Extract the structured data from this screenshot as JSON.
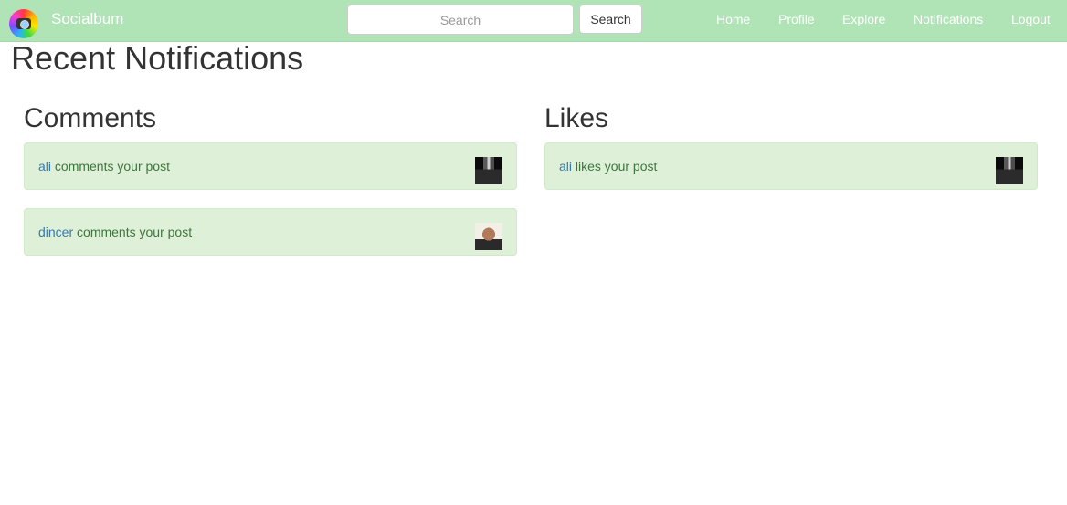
{
  "navbar": {
    "brand": "Socialbum",
    "logo_icon": "camera-icon",
    "search": {
      "placeholder": "Search",
      "value": "",
      "button_label": "Search"
    },
    "links": [
      "Home",
      "Profile",
      "Explore",
      "Notifications",
      "Logout"
    ]
  },
  "page": {
    "title": "Recent Notifications"
  },
  "comments": {
    "title": "Comments",
    "items": [
      {
        "user": "ali",
        "text": " comments your post",
        "thumbnail": "night-building-photo"
      },
      {
        "user": "dincer",
        "text": " comments your post",
        "thumbnail": "portrait-photo"
      }
    ]
  },
  "likes": {
    "title": "Likes",
    "items": [
      {
        "user": "ali",
        "text": " likes your post",
        "thumbnail": "night-building-photo"
      }
    ]
  },
  "colors": {
    "navbar_bg": "#b0e3b6",
    "notification_bg": "#dff0d8",
    "notification_text": "#3c763d",
    "link": "#337ab7"
  }
}
